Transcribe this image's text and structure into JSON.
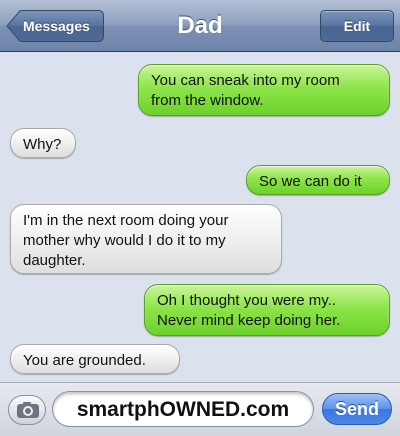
{
  "navbar": {
    "back_label": "Messages",
    "title": "Dad",
    "edit_label": "Edit"
  },
  "messages": [
    {
      "direction": "sent",
      "text": "You can sneak into my room\nfrom the window."
    },
    {
      "direction": "received",
      "text": "Why?"
    },
    {
      "direction": "sent",
      "text": "So we can do it"
    },
    {
      "direction": "received",
      "text": "I'm in the next room doing your\nmother why would I do it to my\ndaughter."
    },
    {
      "direction": "sent",
      "text": "Oh I thought you were my..\nNever mind keep doing her."
    },
    {
      "direction": "received",
      "text": "You are grounded."
    }
  ],
  "input": {
    "camera_icon": "camera-icon",
    "field_text": "smartphOWNED.com",
    "send_label": "Send"
  },
  "colors": {
    "sent_bubble": "#8ee54a",
    "received_bubble": "#ececec",
    "nav_bar": "#7c91b3",
    "send_button": "#4d87e8"
  }
}
